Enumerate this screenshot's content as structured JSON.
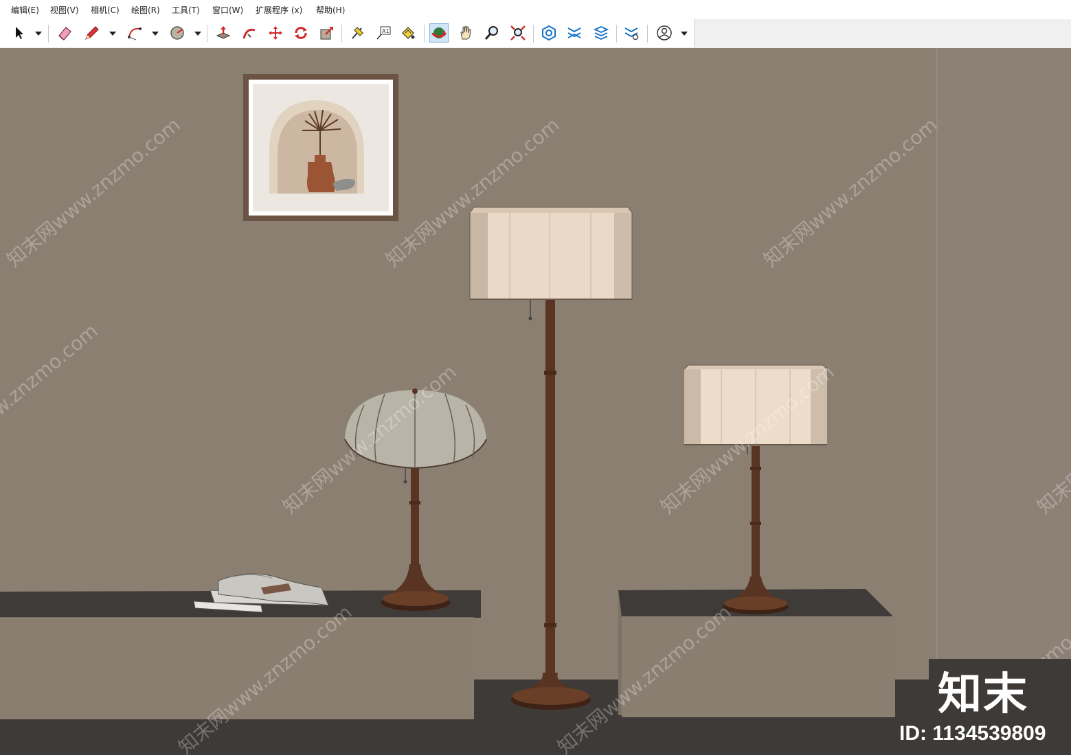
{
  "menu": [
    {
      "label": "编辑(E)"
    },
    {
      "label": "视图(V)"
    },
    {
      "label": "相机(C)"
    },
    {
      "label": "绘图(R)"
    },
    {
      "label": "工具(T)"
    },
    {
      "label": "窗口(W)"
    },
    {
      "label": "扩展程序 (x)"
    },
    {
      "label": "帮助(H)"
    }
  ],
  "toolbar": {
    "tools": [
      "select-tool-icon",
      "eraser-tool-icon",
      "pencil-line-tool-icon",
      "arc-tool-icon",
      "shape-circle-tool-icon",
      "push-pull-tool-icon",
      "follow-me-tool-icon",
      "move-tool-icon",
      "rotate-tool-icon",
      "scale-tool-icon",
      "tape-measure-tool-icon",
      "text-label-tool-icon",
      "paint-bucket-tool-icon",
      "orbit-tool-icon",
      "pan-tool-icon",
      "zoom-tool-icon",
      "zoom-extents-tool-icon",
      "warehouse-icon",
      "extension-warehouse-icon",
      "layout-icon",
      "extension-manager-icon",
      "account-icon"
    ],
    "active_tool": "orbit-tool-icon",
    "text_label_icon_text": "A1"
  },
  "watermark": {
    "text": "知末网www.znzmo.com"
  },
  "brand": {
    "logo": "知末",
    "id": "ID: 1134539809"
  },
  "colors": {
    "wall": "#8b7f72",
    "floor": "#3d3a37",
    "plinth_top": "#3e3b38",
    "plinth_front": "#8a7e71",
    "lamp_wood": "#5a3422",
    "lamp_shade_cream": "#e8d9c8",
    "lamp_shade_grey": "#b9b4a8",
    "frame": "#6b5444"
  }
}
